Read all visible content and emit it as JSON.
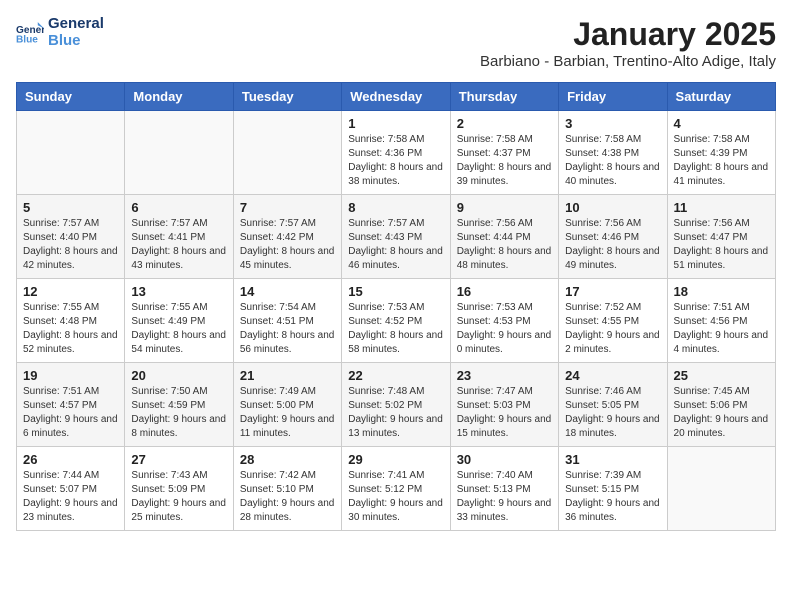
{
  "logo": {
    "text_general": "General",
    "text_blue": "Blue"
  },
  "header": {
    "title": "January 2025",
    "subtitle": "Barbiano - Barbian, Trentino-Alto Adige, Italy"
  },
  "weekdays": [
    "Sunday",
    "Monday",
    "Tuesday",
    "Wednesday",
    "Thursday",
    "Friday",
    "Saturday"
  ],
  "weeks": [
    [
      {
        "day": "",
        "info": ""
      },
      {
        "day": "",
        "info": ""
      },
      {
        "day": "",
        "info": ""
      },
      {
        "day": "1",
        "info": "Sunrise: 7:58 AM\nSunset: 4:36 PM\nDaylight: 8 hours and 38 minutes."
      },
      {
        "day": "2",
        "info": "Sunrise: 7:58 AM\nSunset: 4:37 PM\nDaylight: 8 hours and 39 minutes."
      },
      {
        "day": "3",
        "info": "Sunrise: 7:58 AM\nSunset: 4:38 PM\nDaylight: 8 hours and 40 minutes."
      },
      {
        "day": "4",
        "info": "Sunrise: 7:58 AM\nSunset: 4:39 PM\nDaylight: 8 hours and 41 minutes."
      }
    ],
    [
      {
        "day": "5",
        "info": "Sunrise: 7:57 AM\nSunset: 4:40 PM\nDaylight: 8 hours and 42 minutes."
      },
      {
        "day": "6",
        "info": "Sunrise: 7:57 AM\nSunset: 4:41 PM\nDaylight: 8 hours and 43 minutes."
      },
      {
        "day": "7",
        "info": "Sunrise: 7:57 AM\nSunset: 4:42 PM\nDaylight: 8 hours and 45 minutes."
      },
      {
        "day": "8",
        "info": "Sunrise: 7:57 AM\nSunset: 4:43 PM\nDaylight: 8 hours and 46 minutes."
      },
      {
        "day": "9",
        "info": "Sunrise: 7:56 AM\nSunset: 4:44 PM\nDaylight: 8 hours and 48 minutes."
      },
      {
        "day": "10",
        "info": "Sunrise: 7:56 AM\nSunset: 4:46 PM\nDaylight: 8 hours and 49 minutes."
      },
      {
        "day": "11",
        "info": "Sunrise: 7:56 AM\nSunset: 4:47 PM\nDaylight: 8 hours and 51 minutes."
      }
    ],
    [
      {
        "day": "12",
        "info": "Sunrise: 7:55 AM\nSunset: 4:48 PM\nDaylight: 8 hours and 52 minutes."
      },
      {
        "day": "13",
        "info": "Sunrise: 7:55 AM\nSunset: 4:49 PM\nDaylight: 8 hours and 54 minutes."
      },
      {
        "day": "14",
        "info": "Sunrise: 7:54 AM\nSunset: 4:51 PM\nDaylight: 8 hours and 56 minutes."
      },
      {
        "day": "15",
        "info": "Sunrise: 7:53 AM\nSunset: 4:52 PM\nDaylight: 8 hours and 58 minutes."
      },
      {
        "day": "16",
        "info": "Sunrise: 7:53 AM\nSunset: 4:53 PM\nDaylight: 9 hours and 0 minutes."
      },
      {
        "day": "17",
        "info": "Sunrise: 7:52 AM\nSunset: 4:55 PM\nDaylight: 9 hours and 2 minutes."
      },
      {
        "day": "18",
        "info": "Sunrise: 7:51 AM\nSunset: 4:56 PM\nDaylight: 9 hours and 4 minutes."
      }
    ],
    [
      {
        "day": "19",
        "info": "Sunrise: 7:51 AM\nSunset: 4:57 PM\nDaylight: 9 hours and 6 minutes."
      },
      {
        "day": "20",
        "info": "Sunrise: 7:50 AM\nSunset: 4:59 PM\nDaylight: 9 hours and 8 minutes."
      },
      {
        "day": "21",
        "info": "Sunrise: 7:49 AM\nSunset: 5:00 PM\nDaylight: 9 hours and 11 minutes."
      },
      {
        "day": "22",
        "info": "Sunrise: 7:48 AM\nSunset: 5:02 PM\nDaylight: 9 hours and 13 minutes."
      },
      {
        "day": "23",
        "info": "Sunrise: 7:47 AM\nSunset: 5:03 PM\nDaylight: 9 hours and 15 minutes."
      },
      {
        "day": "24",
        "info": "Sunrise: 7:46 AM\nSunset: 5:05 PM\nDaylight: 9 hours and 18 minutes."
      },
      {
        "day": "25",
        "info": "Sunrise: 7:45 AM\nSunset: 5:06 PM\nDaylight: 9 hours and 20 minutes."
      }
    ],
    [
      {
        "day": "26",
        "info": "Sunrise: 7:44 AM\nSunset: 5:07 PM\nDaylight: 9 hours and 23 minutes."
      },
      {
        "day": "27",
        "info": "Sunrise: 7:43 AM\nSunset: 5:09 PM\nDaylight: 9 hours and 25 minutes."
      },
      {
        "day": "28",
        "info": "Sunrise: 7:42 AM\nSunset: 5:10 PM\nDaylight: 9 hours and 28 minutes."
      },
      {
        "day": "29",
        "info": "Sunrise: 7:41 AM\nSunset: 5:12 PM\nDaylight: 9 hours and 30 minutes."
      },
      {
        "day": "30",
        "info": "Sunrise: 7:40 AM\nSunset: 5:13 PM\nDaylight: 9 hours and 33 minutes."
      },
      {
        "day": "31",
        "info": "Sunrise: 7:39 AM\nSunset: 5:15 PM\nDaylight: 9 hours and 36 minutes."
      },
      {
        "day": "",
        "info": ""
      }
    ]
  ]
}
